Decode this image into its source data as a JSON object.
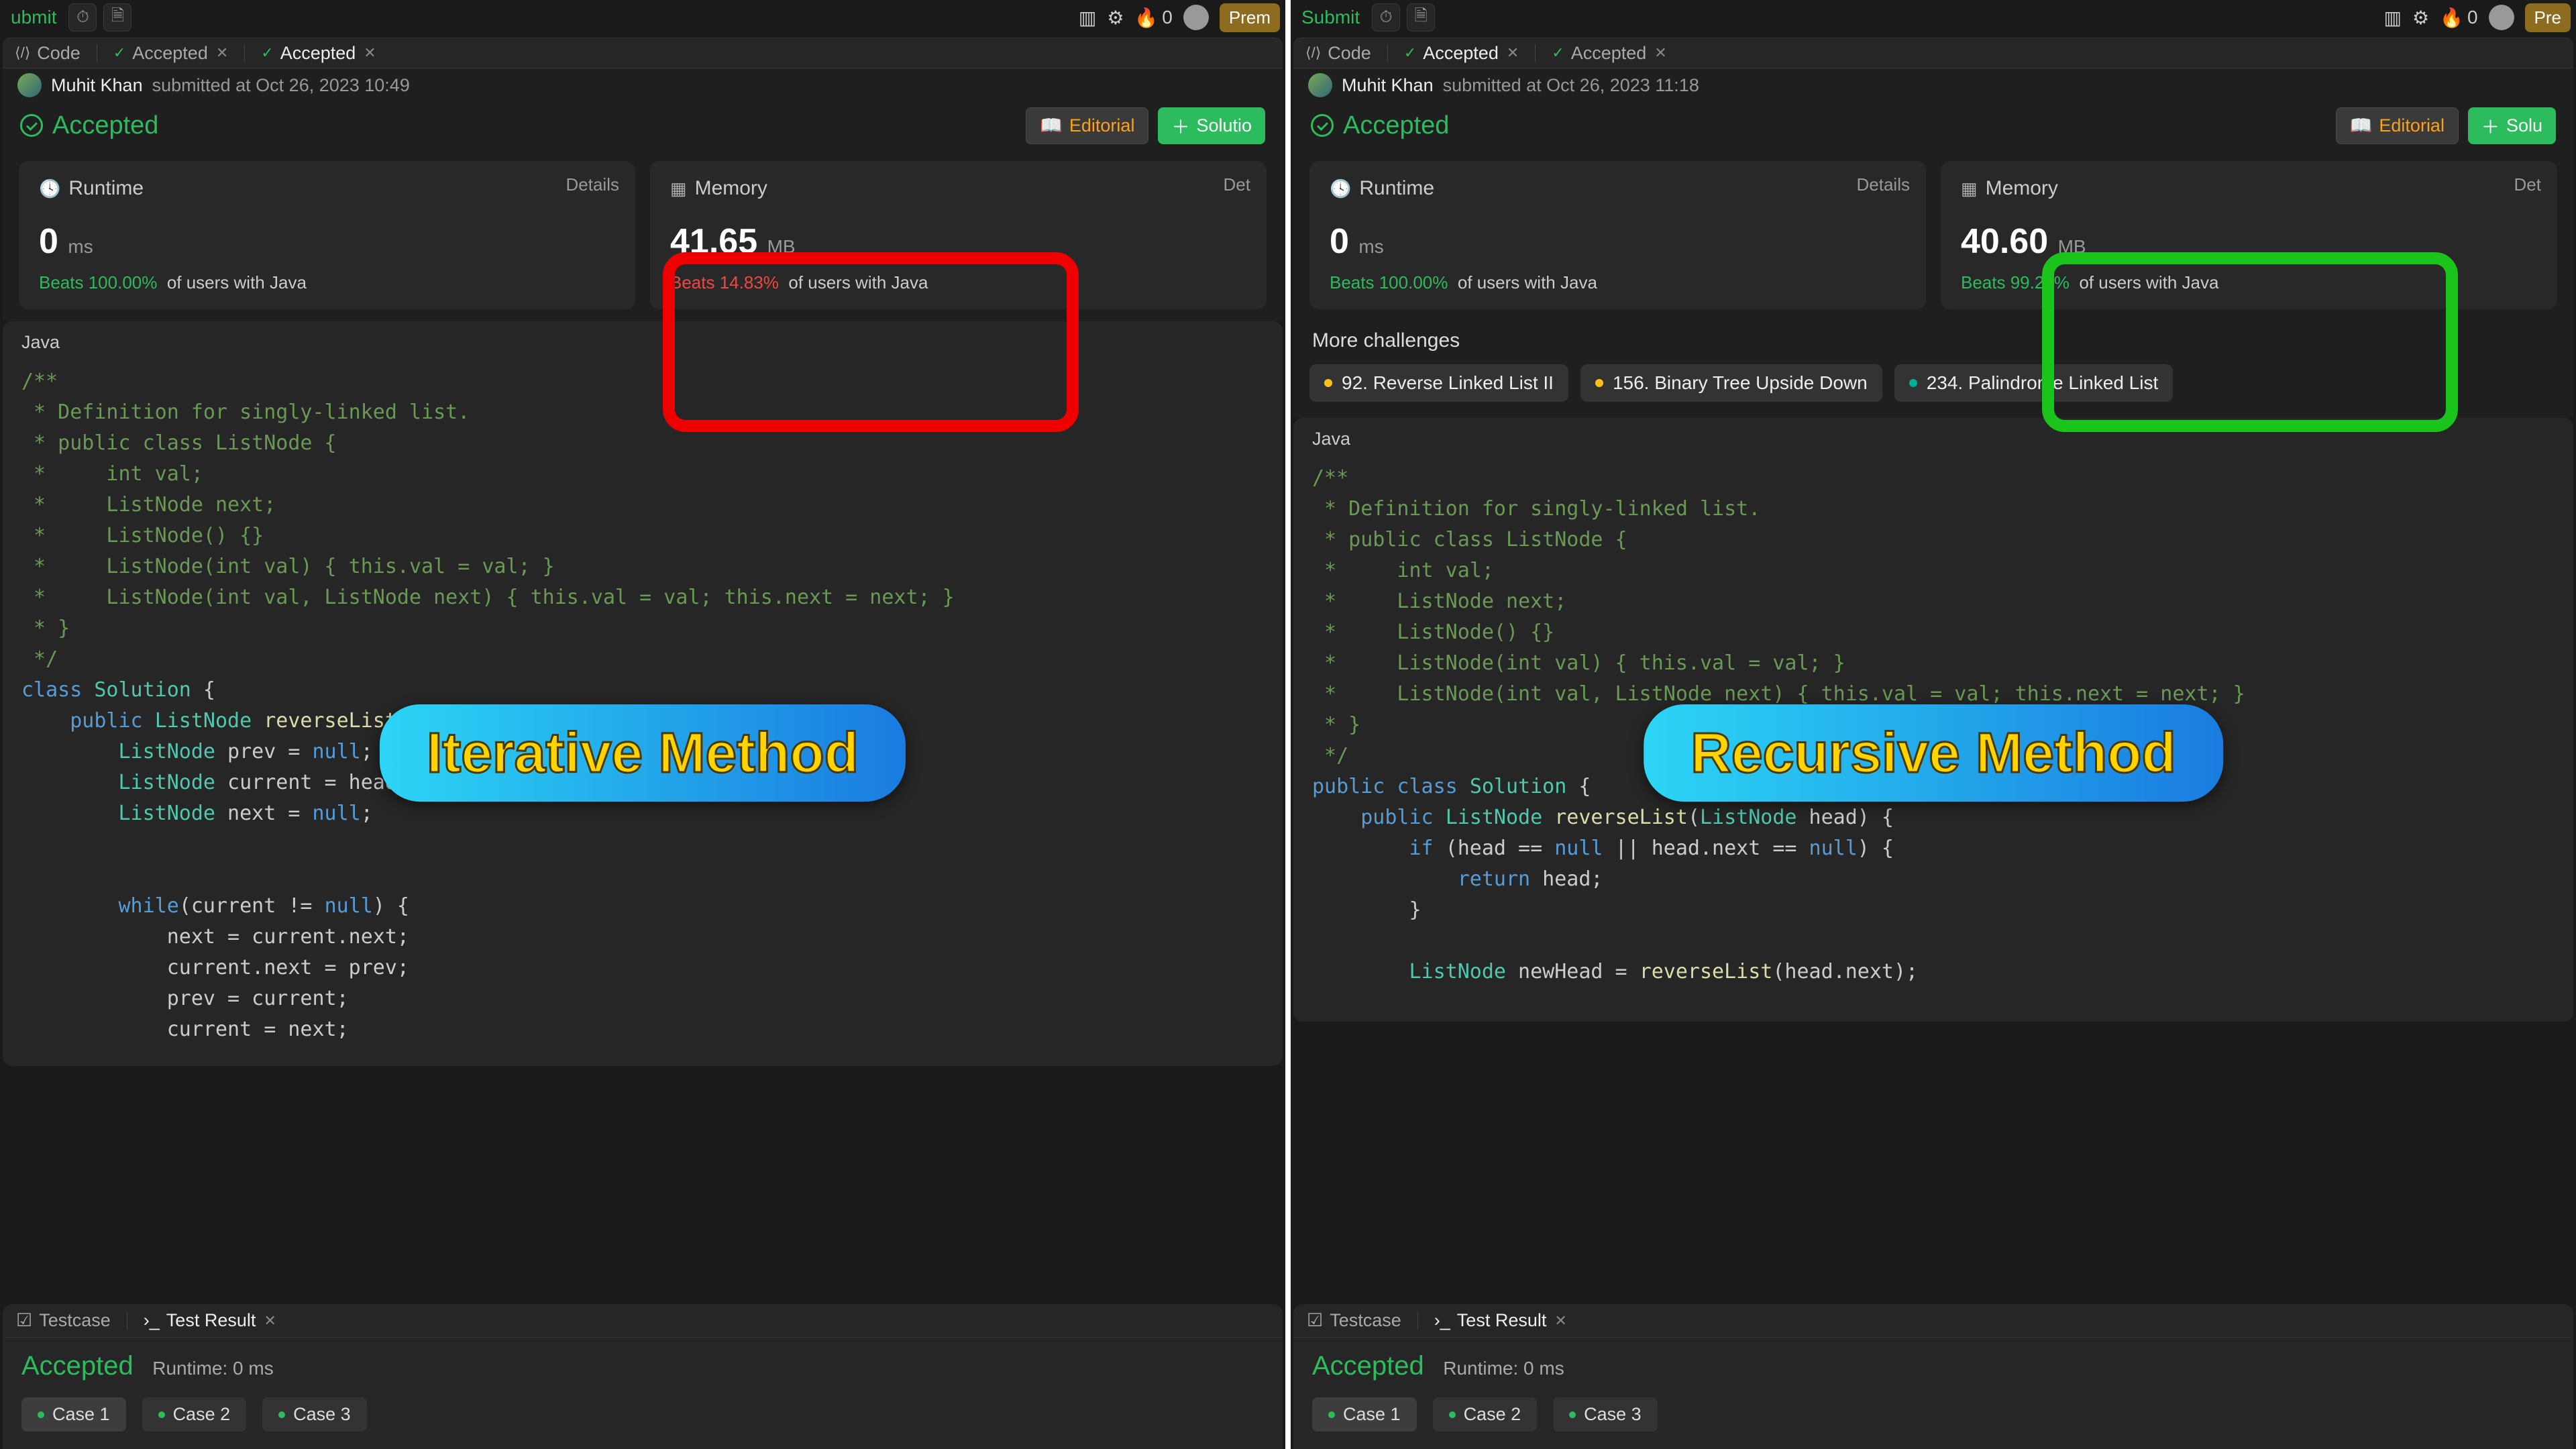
{
  "left": {
    "topbar": {
      "submit": "ubmit",
      "streak": "0",
      "premium": "Prem"
    },
    "tabs": {
      "code": "Code",
      "accepted1": "Accepted",
      "accepted2": "Accepted"
    },
    "user": {
      "name": "Muhit Khan",
      "submitted": "submitted at Oct 26, 2023 10:49"
    },
    "hdr": {
      "title": "Accepted",
      "editorial": "Editorial",
      "solution": "Solutio"
    },
    "runtime": {
      "label": "Runtime",
      "details": "Details",
      "val": "0",
      "unit": "ms",
      "beats_pct": "Beats 100.00%",
      "beats_txt": "of users with Java"
    },
    "memory": {
      "label": "Memory",
      "details": "Det",
      "val": "41.65",
      "unit": "MB",
      "beats_pct": "Beats 14.83%",
      "beats_txt": "of users with Java"
    },
    "lang": "Java",
    "code": "/**\n * Definition for singly-linked list.\n * public class ListNode {\n *     int val;\n *     ListNode next;\n *     ListNode() {}\n *     ListNode(int val) { this.val = val; }\n *     ListNode(int val, ListNode next) { this.val = val; this.next = next; }\n * }\n */\nclass Solution {\n    public ListNode reverseList(ListNode head) {\n        ListNode prev = null;\n        ListNode current = head;\n        ListNode next = null;\n\n\n        while(current != null) {\n            next = current.next;\n            current.next = prev;\n            prev = current;\n            current = next;",
    "badge": "Iterative Method",
    "bott": {
      "testcase": "Testcase",
      "testres": "Test Result",
      "acc": "Accepted",
      "rt": "Runtime: 0 ms",
      "cases": [
        "Case 1",
        "Case 2",
        "Case 3"
      ]
    }
  },
  "right": {
    "topbar": {
      "submit": "Submit",
      "streak": "0",
      "premium": "Pre"
    },
    "tabs": {
      "code": "Code",
      "accepted1": "Accepted",
      "accepted2": "Accepted"
    },
    "user": {
      "name": "Muhit Khan",
      "submitted": "submitted at Oct 26, 2023 11:18"
    },
    "hdr": {
      "title": "Accepted",
      "editorial": "Editorial",
      "solution": "Solu"
    },
    "runtime": {
      "label": "Runtime",
      "details": "Details",
      "val": "0",
      "unit": "ms",
      "beats_pct": "Beats 100.00%",
      "beats_txt": "of users with Java"
    },
    "memory": {
      "label": "Memory",
      "details": "Det",
      "val": "40.60",
      "unit": "MB",
      "beats_pct": "Beats 99.21%",
      "beats_txt": "of users with Java"
    },
    "more": "More challenges",
    "ch": [
      "92. Reverse Linked List II",
      "156. Binary Tree Upside Down",
      "234. Palindrome Linked List"
    ],
    "lang": "Java",
    "code": "/**\n * Definition for singly-linked list.\n * public class ListNode {\n *     int val;\n *     ListNode next;\n *     ListNode() {}\n *     ListNode(int val) { this.val = val; }\n *     ListNode(int val, ListNode next) { this.val = val; this.next = next; }\n * }\n */\npublic class Solution {\n    public ListNode reverseList(ListNode head) {\n        if (head == null || head.next == null) {\n            return head;\n        }\n\n        ListNode newHead = reverseList(head.next);",
    "badge": "Recursive Method",
    "bott": {
      "testcase": "Testcase",
      "testres": "Test Result",
      "acc": "Accepted",
      "rt": "Runtime: 0 ms",
      "cases": [
        "Case 1",
        "Case 2",
        "Case 3"
      ]
    }
  }
}
